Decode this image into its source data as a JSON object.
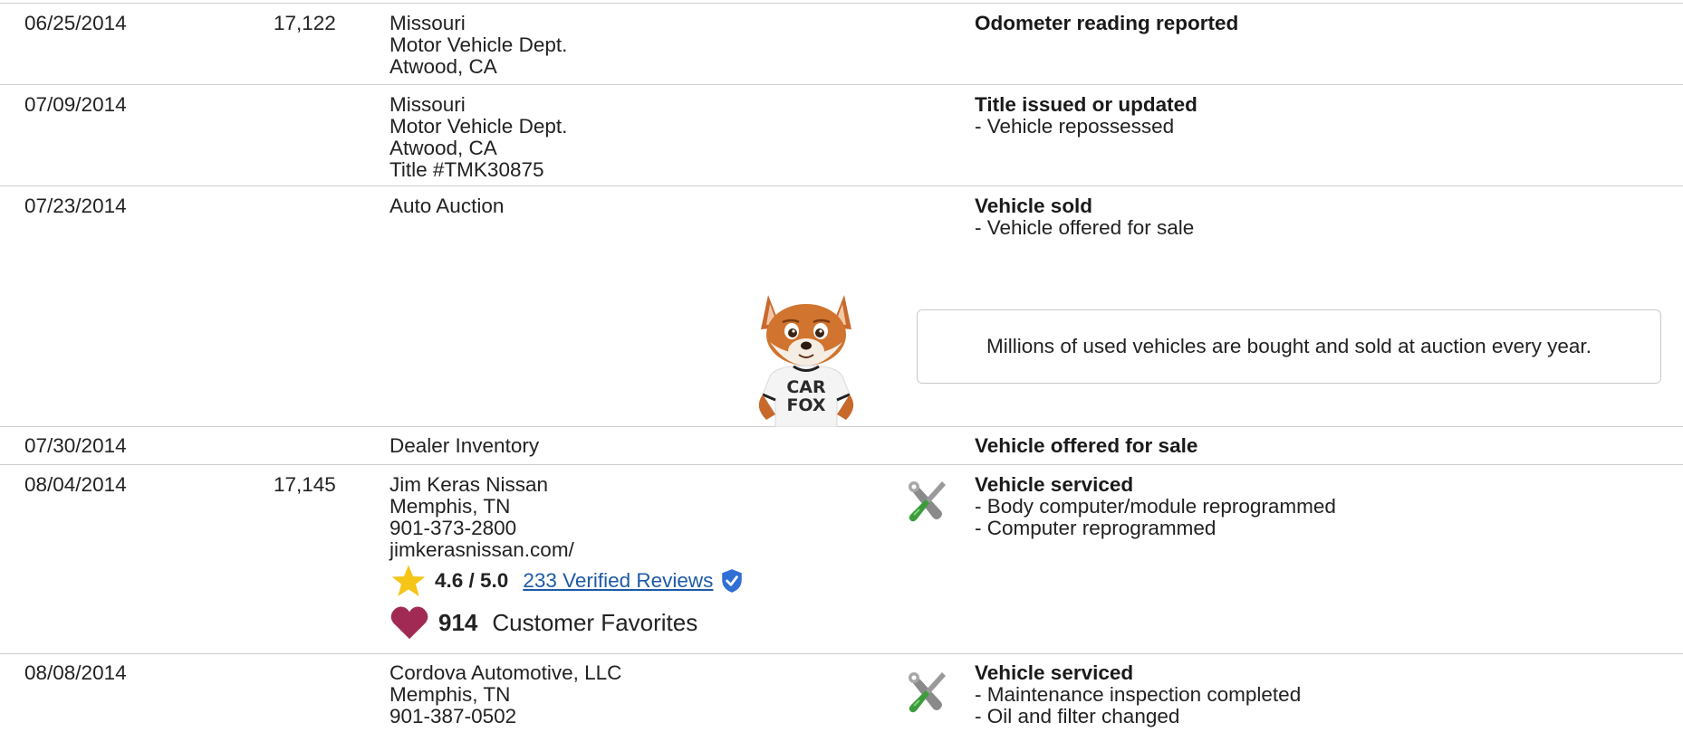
{
  "rows": [
    {
      "date": "06/25/2014",
      "odometer": "17,122",
      "source": [
        "Missouri",
        "Motor Vehicle Dept.",
        "Atwood, CA"
      ],
      "comment_head": "Odometer reading reported",
      "comment_lines": []
    },
    {
      "date": "07/09/2014",
      "odometer": "",
      "source": [
        "Missouri",
        "Motor Vehicle Dept.",
        "Atwood, CA",
        "Title #TMK30875"
      ],
      "comment_head": "Title issued or updated",
      "comment_lines": [
        "- Vehicle repossessed"
      ]
    },
    {
      "date": "07/23/2014",
      "odometer": "",
      "source": [
        "Auto Auction"
      ],
      "comment_head": "Vehicle sold",
      "comment_lines": [
        "- Vehicle offered for sale"
      ],
      "tip": "Millions of used vehicles are bought and sold at auction every year."
    },
    {
      "date": "07/30/2014",
      "odometer": "",
      "source": [
        "Dealer Inventory"
      ],
      "comment_head": "Vehicle offered for sale",
      "comment_lines": []
    },
    {
      "date": "08/04/2014",
      "odometer": "17,145",
      "source": [
        "Jim Keras Nissan",
        "Memphis, TN",
        "901-373-2800",
        "jimkerasnissan.com/"
      ],
      "comment_head": "Vehicle serviced",
      "comment_lines": [
        "- Body computer/module reprogrammed",
        "- Computer reprogrammed"
      ],
      "rating": {
        "score": "4.6 / 5.0",
        "reviews": "233 Verified Reviews"
      },
      "favorites": {
        "count": "914",
        "label": "Customer Favorites"
      }
    },
    {
      "date": "08/08/2014",
      "odometer": "",
      "source": [
        "Cordova Automotive, LLC",
        "Memphis, TN",
        "901-387-0502"
      ],
      "comment_head": "Vehicle serviced",
      "comment_lines": [
        "- Maintenance inspection completed",
        "- Oil and filter changed"
      ]
    }
  ],
  "mascot": {
    "shirt_text": [
      "CAR",
      "FOX"
    ]
  },
  "icons": {
    "service": "wrench-screwdriver-icon",
    "star": "star-icon",
    "verified": "verified-shield-icon",
    "heart": "heart-icon"
  },
  "colors": {
    "link": "#1e5aa8",
    "star": "#f5c518",
    "heart": "#a12a55",
    "verified": "#2f6fd6",
    "rule": "#cfcfcf"
  }
}
